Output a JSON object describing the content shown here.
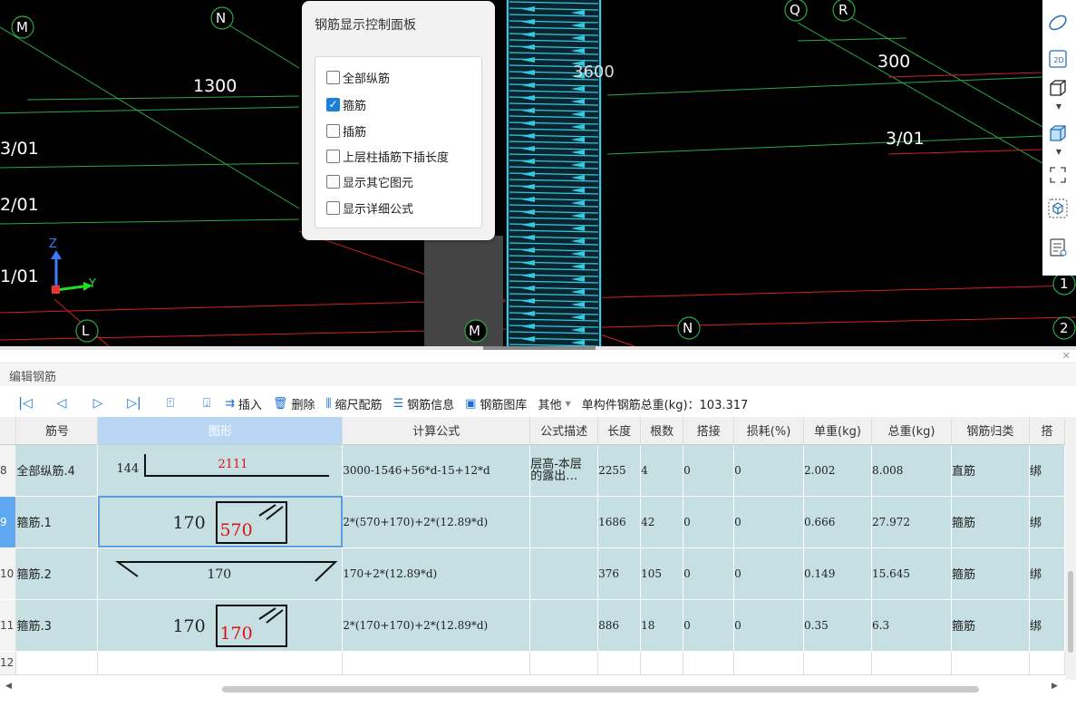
{
  "viewport": {
    "axis_labels": {
      "M": "M",
      "N": "N",
      "Q": "Q",
      "R": "R",
      "L": "L",
      "M2": "M",
      "N2": "N",
      "r1": "1",
      "r2": "2"
    },
    "dims": {
      "d1300": "1300",
      "d300": "300",
      "d3600": "3600"
    },
    "grid_labels": {
      "g3_01": "3/01",
      "g2_01": "2/01",
      "g1_01": "1/01",
      "g3_01r": "3/01"
    },
    "triad": {
      "z": "Z",
      "y": "Y"
    },
    "colors": {
      "background": "#000000",
      "green_line": "#2aa84a",
      "red_line": "#d42020",
      "rebar": "#34c9e0"
    }
  },
  "control_panel": {
    "title": "钢筋显示控制面板",
    "options": [
      {
        "label": "全部纵筋",
        "checked": false
      },
      {
        "label": "箍筋",
        "checked": true
      },
      {
        "label": "插筋",
        "checked": false
      },
      {
        "label": "上层柱插筋下插长度",
        "checked": false
      },
      {
        "label": "显示其它图元",
        "checked": false
      },
      {
        "label": "显示详细公式",
        "checked": false
      }
    ]
  },
  "right_toolbar": {
    "icons": [
      "orbit-icon",
      "view-2d-icon",
      "cube-outline-icon",
      "cube-filled-icon",
      "fullscreen-icon",
      "cube-select-icon",
      "layer-view-icon"
    ],
    "label_2d": "2D"
  },
  "panel": {
    "title": "编辑钢筋",
    "toolbar": {
      "insert": "插入",
      "delete": "删除",
      "scale": "缩尺配筋",
      "info": "钢筋信息",
      "library": "钢筋图库",
      "other": "其他",
      "weight_label": "单构件钢筋总重(kg)：103.317"
    }
  },
  "table": {
    "columns": [
      "筋号",
      "图形",
      "计算公式",
      "公式描述",
      "长度",
      "根数",
      "搭接",
      "损耗(%)",
      "单重(kg)",
      "总重(kg)",
      "钢筋归类",
      "搭"
    ],
    "rows": [
      {
        "num": "8",
        "name": "全部纵筋.4",
        "formula": "3000-1546+56*d-15+12*d",
        "desc": "层高-本层\n的露出…",
        "length": "2255",
        "count": "4",
        "lap": "0",
        "loss": "0",
        "unit_w": "2.002",
        "total_w": "8.008",
        "cat": "直筋",
        "tie": "绑",
        "shape_a": "144",
        "shape_b": "2111"
      },
      {
        "num": "9",
        "name": "箍筋.1",
        "formula": "2*(570+170)+2*(12.89*d)",
        "desc": "",
        "length": "1686",
        "count": "42",
        "lap": "0",
        "loss": "0",
        "unit_w": "0.666",
        "total_w": "27.972",
        "cat": "箍筋",
        "tie": "绑",
        "shape_a": "170",
        "shape_b": "570"
      },
      {
        "num": "10",
        "name": "箍筋.2",
        "formula": "170+2*(12.89*d)",
        "desc": "",
        "length": "376",
        "count": "105",
        "lap": "0",
        "loss": "0",
        "unit_w": "0.149",
        "total_w": "15.645",
        "cat": "箍筋",
        "tie": "绑",
        "shape_a": "170",
        "shape_b": ""
      },
      {
        "num": "11",
        "name": "箍筋.3",
        "formula": "2*(170+170)+2*(12.89*d)",
        "desc": "",
        "length": "886",
        "count": "18",
        "lap": "0",
        "loss": "0",
        "unit_w": "0.35",
        "total_w": "6.3",
        "cat": "箍筋",
        "tie": "绑",
        "shape_a": "170",
        "shape_b": "170"
      },
      {
        "num": "12",
        "name": "",
        "formula": "",
        "desc": "",
        "length": "",
        "count": "",
        "lap": "",
        "loss": "",
        "unit_w": "",
        "total_w": "",
        "cat": "",
        "tie": "",
        "shape_a": "",
        "shape_b": ""
      }
    ]
  }
}
